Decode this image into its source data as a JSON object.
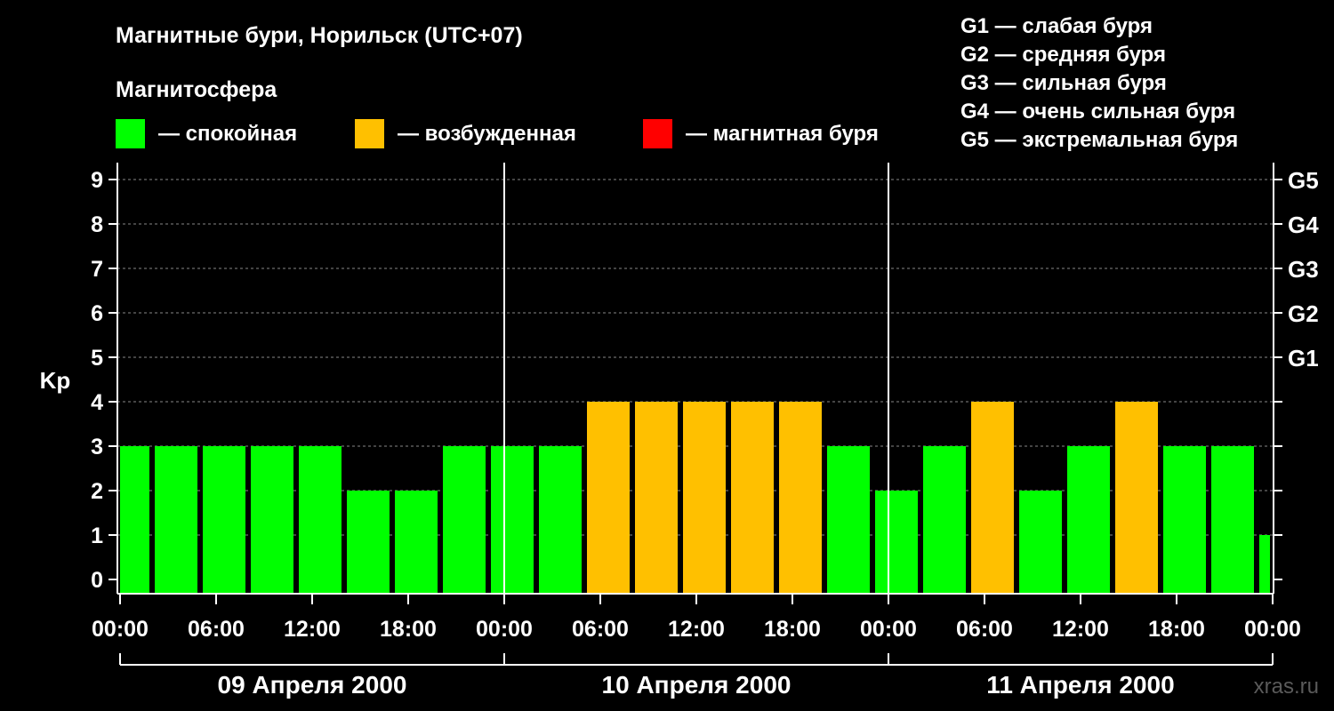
{
  "chart_data": {
    "type": "bar",
    "title": "Магнитные бури, Норильск (UTC+07)",
    "legend_title": "Магнитосфера",
    "legend": [
      {
        "label": "— спокойная",
        "color": "#00ff00"
      },
      {
        "label": "— возбужденная",
        "color": "#ffc000"
      },
      {
        "label": "— магнитная буря",
        "color": "#ff0000"
      }
    ],
    "storm_scale": [
      "G1 — слабая буря",
      "G2 — средняя буря",
      "G3 — сильная буря",
      "G4 — очень сильная буря",
      "G5 — экстремальная буря"
    ],
    "ylabel": "Kp",
    "ylim": [
      0,
      9
    ],
    "yticks": [
      "0",
      "1",
      "2",
      "3",
      "4",
      "5",
      "6",
      "7",
      "8",
      "9"
    ],
    "right_ticks": [
      {
        "kp": 5,
        "label": "G1"
      },
      {
        "kp": 6,
        "label": "G2"
      },
      {
        "kp": 7,
        "label": "G3"
      },
      {
        "kp": 8,
        "label": "G4"
      },
      {
        "kp": 9,
        "label": "G5"
      }
    ],
    "xticks": [
      "00:00",
      "06:00",
      "12:00",
      "18:00",
      "00:00",
      "06:00",
      "12:00",
      "18:00",
      "00:00",
      "06:00",
      "12:00",
      "18:00",
      "00:00"
    ],
    "dates": [
      "09 Апреля 2000",
      "10 Апреля 2000",
      "11 Апреля 2000"
    ],
    "series": [
      {
        "values": [
          3,
          3,
          3,
          3,
          3,
          2,
          2,
          3,
          3,
          3,
          4,
          4,
          4,
          4,
          4,
          3,
          2,
          3,
          4,
          2,
          3,
          4,
          3,
          3,
          1
        ]
      }
    ],
    "colors": {
      "quiet": "#00ff00",
      "active": "#ffc000",
      "storm": "#ff0000"
    },
    "grid": true,
    "watermark": "xras.ru"
  }
}
